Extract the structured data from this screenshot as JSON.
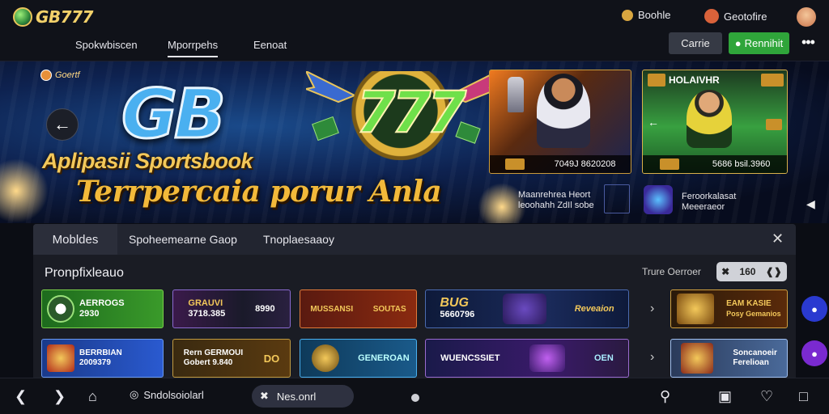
{
  "header": {
    "logo_text": "GB777",
    "right_item_1": "Boohle",
    "right_item_2": "Geotofire"
  },
  "nav": {
    "tabs": [
      "Spokwbiscen",
      "Mporrpehs",
      "Eenoat"
    ],
    "active_tab": "Mporrpehs",
    "game_button": "Carrie",
    "register_button": "Rennihit"
  },
  "hero": {
    "badge": "Goertf",
    "logo_word": "GB",
    "logo_number": "777",
    "subtitle": "Aplipasii Sportsbook",
    "tagline": "Terrpercaia porur Anla",
    "card1_footer": "7049J 8620208",
    "card2_title": "HOLAIVHR",
    "card2_footer": "5686 bsil.3960",
    "promo1_line1": "Maanrehrea Heort",
    "promo1_line2": "leoohahh ZdIl sobe",
    "promo2_line1": "Feroorkalasat",
    "promo2_line2": "Meeeraeor"
  },
  "panel": {
    "tabs": [
      "Mobldes",
      "Spoheemearne Gaop",
      "Tnoplaesaaoy"
    ],
    "section_title": "Pronpfixleauo",
    "section_right": "Trure Oerroer",
    "pill_value": "160",
    "tiles_row1": [
      {
        "title": "AERROGS",
        "sub": "2930"
      },
      {
        "title": "GRAUVI",
        "sub": "3718.385",
        "extra": "8990"
      },
      {
        "title": "MUSSANSI",
        "sub": "SOUTAS"
      },
      {
        "title": "BUG",
        "sub": "5660796",
        "extra": "Reveaion"
      },
      {
        "title": "EAM KASIE",
        "sub": "Posy Gemanios"
      }
    ],
    "tiles_row2": [
      {
        "title": "BERRBIAN",
        "sub": "2009379"
      },
      {
        "title": "Rern GERMOUI",
        "sub": "Gobert 9.840",
        "extra": "DO"
      },
      {
        "title": "GENEROAN"
      },
      {
        "title": "WUENCSSIET",
        "extra": "OEN"
      },
      {
        "title": "Soncanoeir",
        "sub": "Ferelioan"
      }
    ]
  },
  "bottombar": {
    "search_text": "Sndolsoiolarl",
    "pill_text": "Nes.onrl"
  },
  "colors": {
    "accent_green": "#2fa53a",
    "gold": "#f3c85a",
    "blue": "#4ab0f0"
  }
}
